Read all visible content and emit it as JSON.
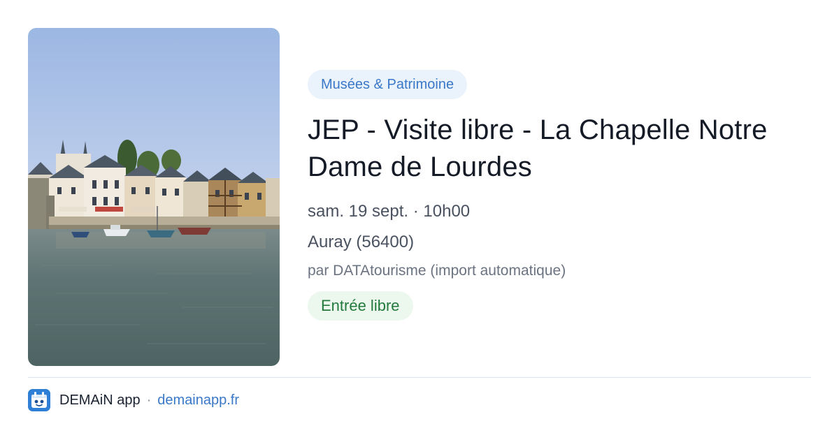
{
  "event": {
    "category": "Musées & Patrimoine",
    "title": "JEP - Visite libre - La Chapelle Notre Dame de Lourdes",
    "datetime": "sam. 19 sept. · 10h00",
    "location": "Auray (56400)",
    "organizer": "par DATAtourisme (import automatique)",
    "price": "Entrée libre"
  },
  "footer": {
    "app_name": "DEMAiN app",
    "separator": "·",
    "url": "demainapp.fr",
    "logo_icon": "calendar-face-icon"
  },
  "colors": {
    "accent": "#3a78c8",
    "category_bg": "#eaf2fc",
    "price_text": "#237a3c",
    "price_bg": "#ecf8ee",
    "logo_bg": "#2f7fd6"
  }
}
